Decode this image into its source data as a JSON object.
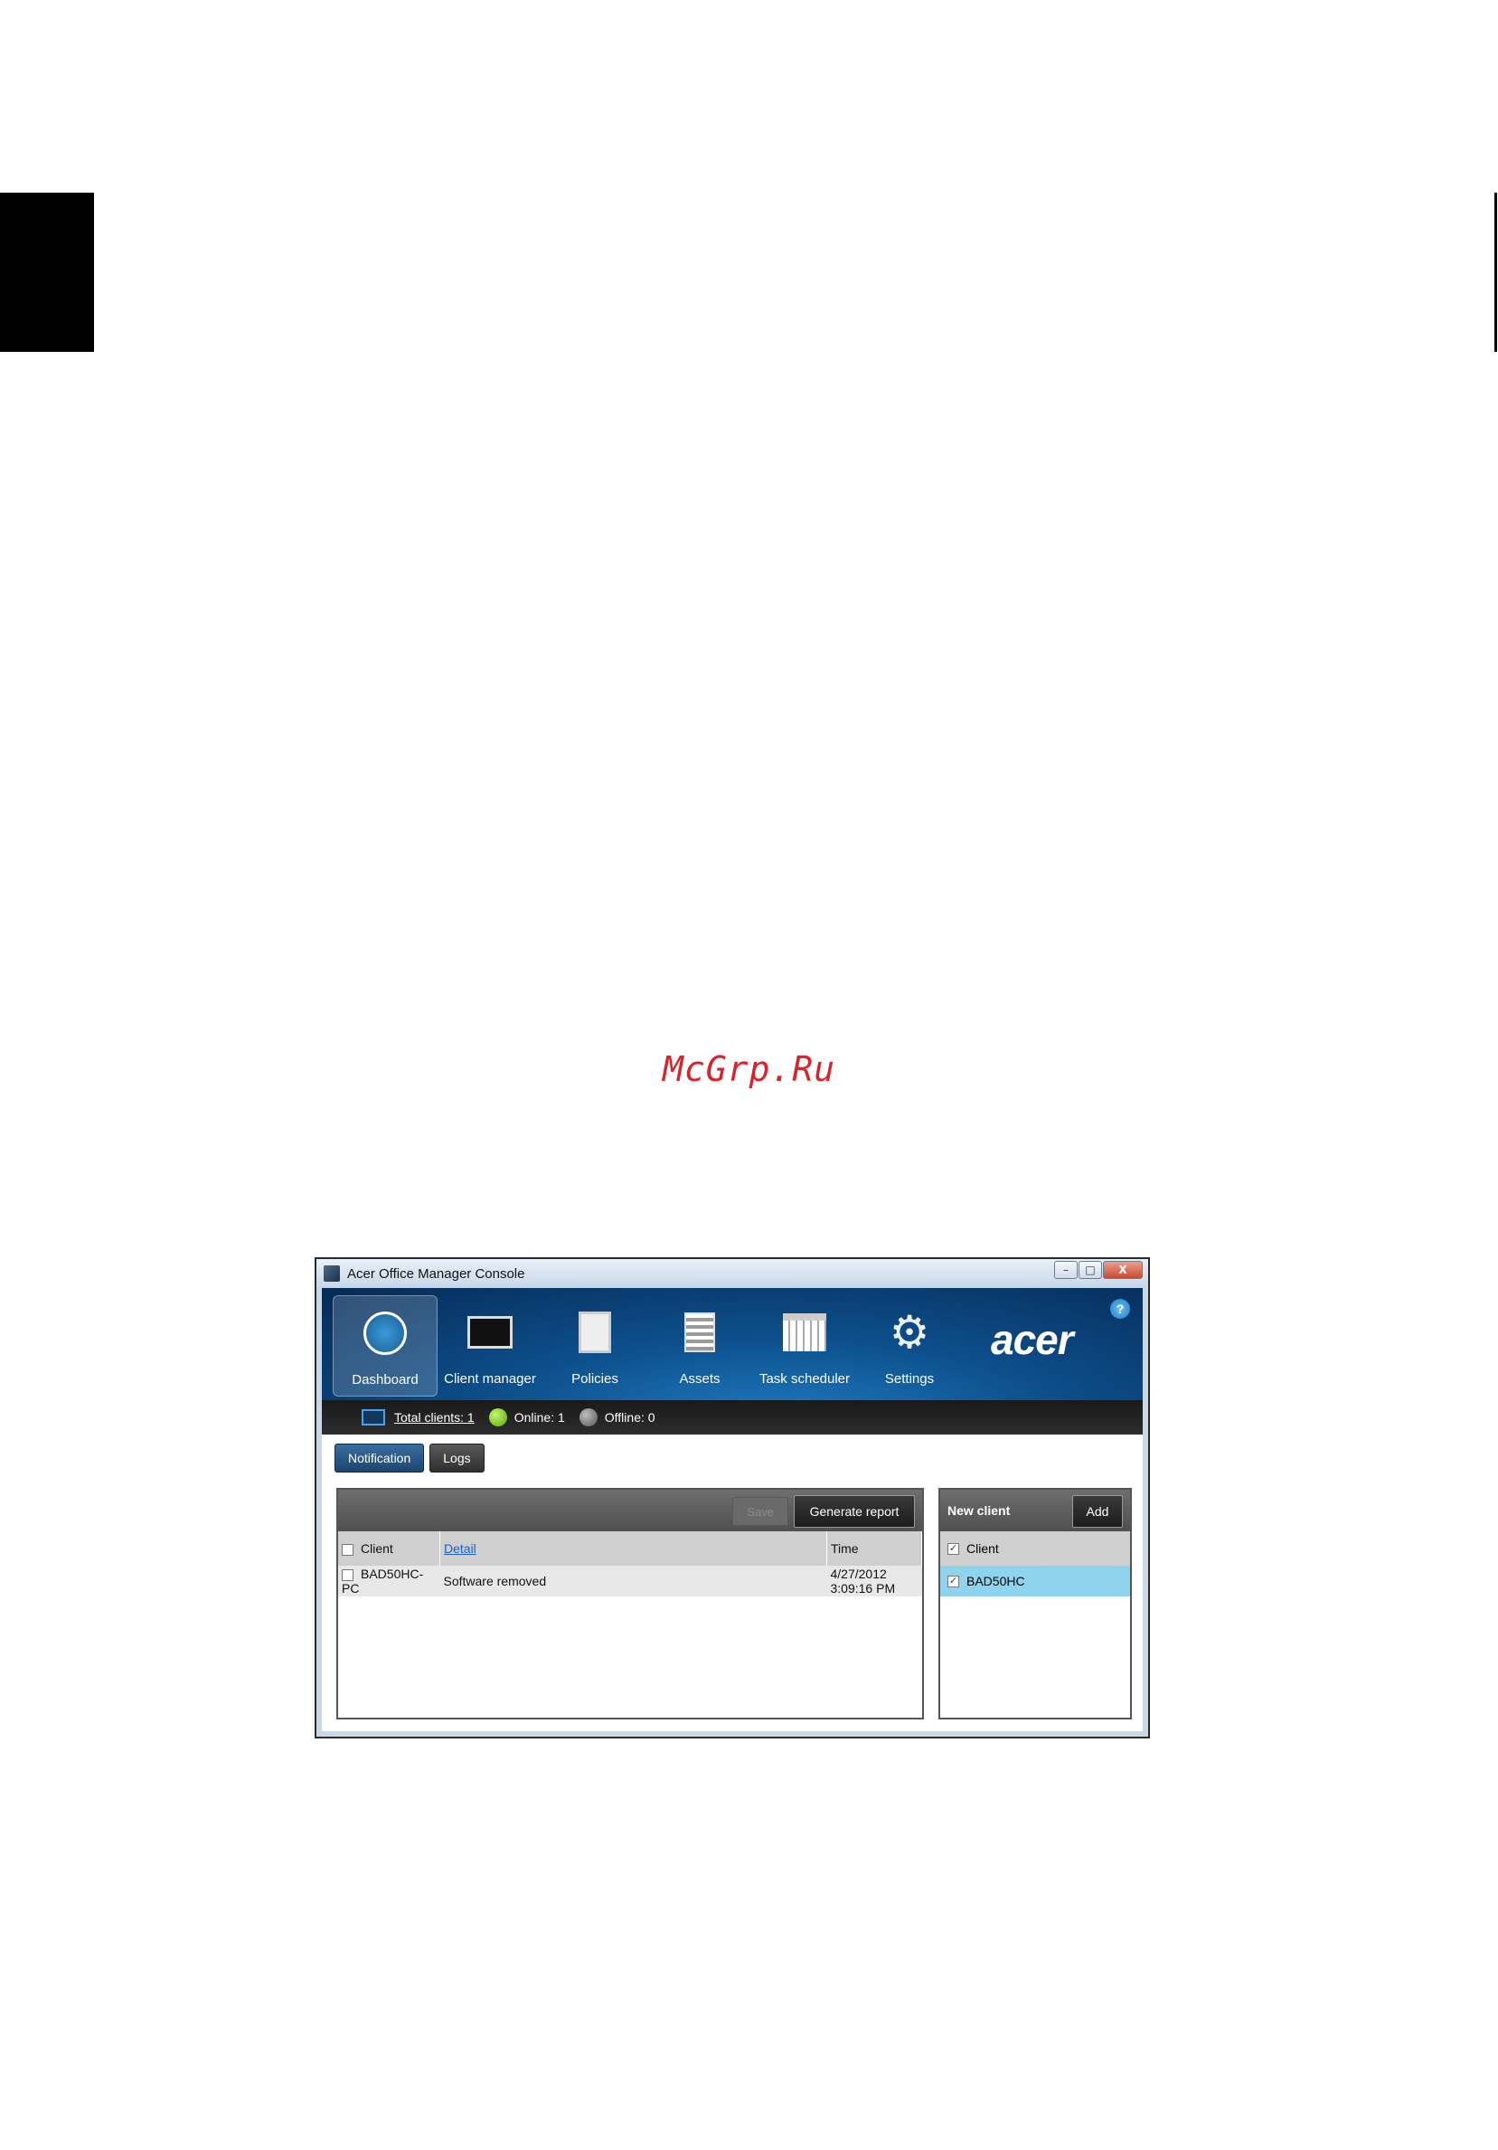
{
  "page": {
    "watermark": "McGrp.Ru"
  },
  "window": {
    "title": "Acer Office Manager Console",
    "controls": {
      "minimize": "–",
      "maximize": "□",
      "close": "X"
    }
  },
  "ribbon": {
    "brand": "acer",
    "help": "?",
    "nav": [
      {
        "label": "Dashboard",
        "icon": "dashboard-gauge-icon"
      },
      {
        "label": "Client manager",
        "icon": "monitor-icon"
      },
      {
        "label": "Policies",
        "icon": "clipboard-icon"
      },
      {
        "label": "Assets",
        "icon": "assets-list-icon"
      },
      {
        "label": "Task scheduler",
        "icon": "calendar-icon"
      },
      {
        "label": "Settings",
        "icon": "gear-icon"
      }
    ]
  },
  "status": {
    "total_clients": "Total clients: 1",
    "online": "Online: 1",
    "offline": "Offline: 0"
  },
  "tabs": [
    {
      "label": "Notification"
    },
    {
      "label": "Logs"
    }
  ],
  "notifications": {
    "save_label": "Save",
    "report_label": "Generate report",
    "columns": [
      "Client",
      "Detail",
      "Time"
    ],
    "rows": [
      {
        "client": "BAD50HC-PC",
        "detail": "Software removed",
        "time": "4/27/2012 3:09:16 PM"
      }
    ]
  },
  "new_client": {
    "title": "New client",
    "add_label": "Add",
    "column": "Client",
    "rows": [
      {
        "name": "BAD50HC",
        "checked": true
      }
    ]
  },
  "colors": {
    "ribbon": "#0d4f8c",
    "selected_row": "#8fd3ec",
    "online": "#58a80a",
    "offline": "#555555",
    "watermark": "#d8232a"
  }
}
